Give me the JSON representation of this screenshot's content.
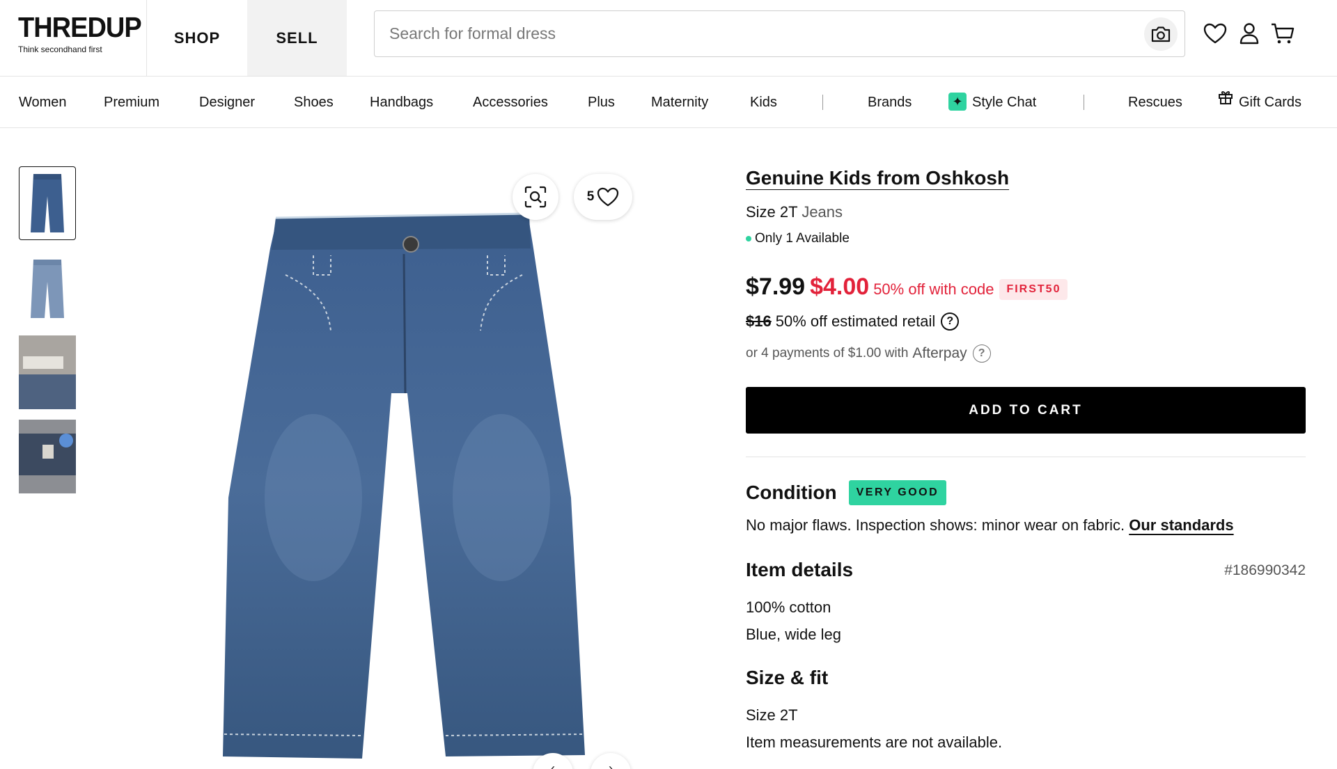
{
  "header": {
    "logo": {
      "brand": "THREDUP",
      "tagline": "Think secondhand first"
    },
    "tabs": [
      "SHOP",
      "SELL"
    ],
    "search_placeholder": "Search for formal dress",
    "icons": [
      "camera-icon",
      "heart-icon",
      "user-icon",
      "cart-icon"
    ]
  },
  "nav": {
    "items": [
      "Women",
      "Premium",
      "Designer",
      "Shoes",
      "Handbags",
      "Accessories",
      "Plus",
      "Maternity",
      "Kids"
    ],
    "brands": "Brands",
    "style_chat": "Style Chat",
    "rescues": "Rescues",
    "gift_cards": "Gift Cards"
  },
  "gallery": {
    "thumbnail_count": 4,
    "favorites_count": "5"
  },
  "product": {
    "title": "Genuine Kids from Oshkosh",
    "size": "Size 2T",
    "type": "Jeans",
    "availability": "Only 1 Available",
    "price": "$7.99",
    "sale_price": "$4.00",
    "promo_text": "50% off with code",
    "promo_code": "FIRST50",
    "retail_price": "$16",
    "retail_text": "50% off estimated retail",
    "afterpay_text": "or 4 payments of $1.00 with",
    "afterpay_brand": "Afterpay",
    "add_to_cart": "ADD TO CART"
  },
  "condition": {
    "heading": "Condition",
    "badge": "VERY GOOD",
    "text": "No major flaws. Inspection shows: minor wear on fabric.",
    "link": "Our standards"
  },
  "item_details": {
    "heading": "Item details",
    "id": "#186990342",
    "lines": [
      "100% cotton",
      "Blue, wide leg"
    ]
  },
  "size_fit": {
    "heading": "Size & fit",
    "lines": [
      "Size 2T",
      "Item measurements are not available."
    ]
  },
  "colors": {
    "accent_green": "#2fd3a0",
    "sale_red": "#e2223a",
    "denim": "#3d5f8f"
  }
}
